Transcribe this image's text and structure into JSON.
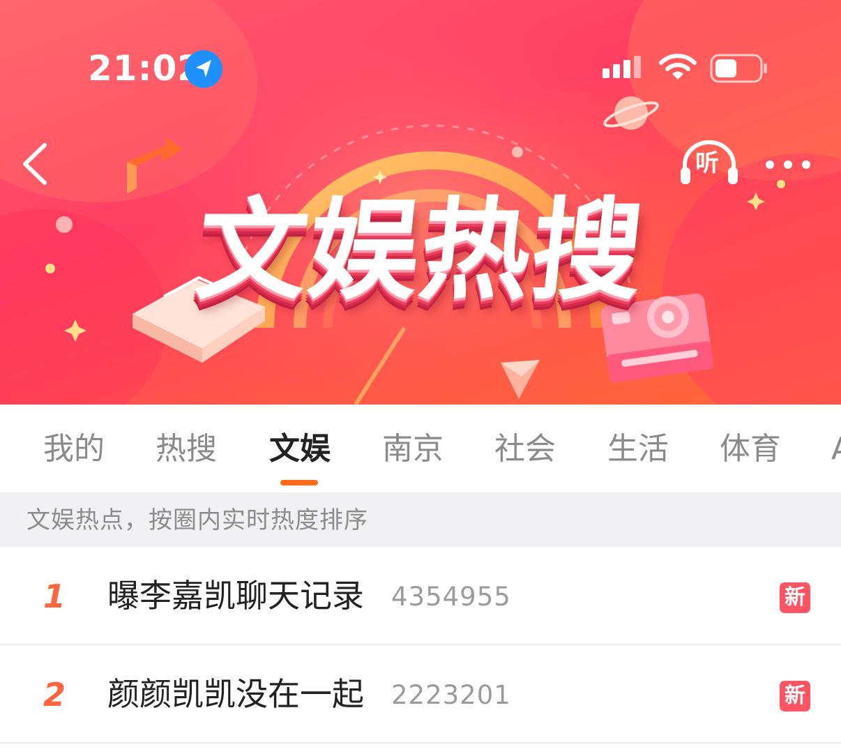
{
  "status_bar": {
    "time": "21:02"
  },
  "header": {
    "title": "文娱热搜",
    "listen_label": "听"
  },
  "tabs": [
    {
      "label": "我的"
    },
    {
      "label": "热搜"
    },
    {
      "label": "文娱",
      "active": true
    },
    {
      "label": "南京"
    },
    {
      "label": "社会"
    },
    {
      "label": "生活"
    },
    {
      "label": "体育"
    },
    {
      "label": "A"
    }
  ],
  "subheader": {
    "text": "文娱热点，按圈内实时热度排序"
  },
  "list": [
    {
      "rank": "1",
      "title": "曝李嘉凯聊天记录",
      "count": "4354955",
      "badge": "新"
    },
    {
      "rank": "2",
      "title": "颜颜凯凯没在一起",
      "count": "2223201",
      "badge": "新"
    }
  ],
  "colors": {
    "banner": "#ff4466",
    "tab_indicator": "#ff6a1a",
    "rank": "#ff6640",
    "badge": "#ff5463"
  },
  "icons": {
    "location": "location-arrow-icon",
    "signal": "cellular-signal-icon",
    "wifi": "wifi-icon",
    "battery": "battery-icon",
    "back": "chevron-left-icon",
    "listen": "headphones-icon",
    "more": "more-dots-icon"
  }
}
